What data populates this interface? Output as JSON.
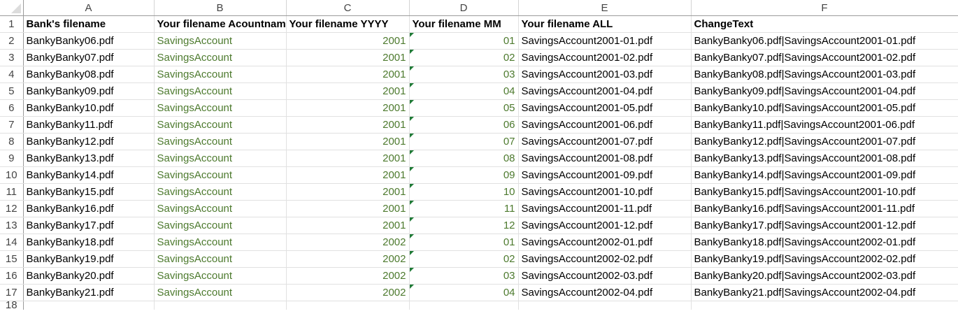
{
  "columns": [
    "A",
    "B",
    "C",
    "D",
    "E",
    "F"
  ],
  "header_row": {
    "num": "1",
    "cells": [
      "Bank's filename",
      "Your filename Acountname",
      "Your filename YYYY",
      "Your filename MM",
      "Your filename ALL",
      "ChangeText"
    ]
  },
  "rows": [
    {
      "num": "2",
      "bank": "BankyBanky06.pdf",
      "acct": "SavingsAccount",
      "yyyy": "2001",
      "mm": "01",
      "all": "SavingsAccount2001-01.pdf",
      "change": "BankyBanky06.pdf|SavingsAccount2001-01.pdf"
    },
    {
      "num": "3",
      "bank": "BankyBanky07.pdf",
      "acct": "SavingsAccount",
      "yyyy": "2001",
      "mm": "02",
      "all": "SavingsAccount2001-02.pdf",
      "change": "BankyBanky07.pdf|SavingsAccount2001-02.pdf"
    },
    {
      "num": "4",
      "bank": "BankyBanky08.pdf",
      "acct": "SavingsAccount",
      "yyyy": "2001",
      "mm": "03",
      "all": "SavingsAccount2001-03.pdf",
      "change": "BankyBanky08.pdf|SavingsAccount2001-03.pdf"
    },
    {
      "num": "5",
      "bank": "BankyBanky09.pdf",
      "acct": "SavingsAccount",
      "yyyy": "2001",
      "mm": "04",
      "all": "SavingsAccount2001-04.pdf",
      "change": "BankyBanky09.pdf|SavingsAccount2001-04.pdf"
    },
    {
      "num": "6",
      "bank": "BankyBanky10.pdf",
      "acct": "SavingsAccount",
      "yyyy": "2001",
      "mm": "05",
      "all": "SavingsAccount2001-05.pdf",
      "change": "BankyBanky10.pdf|SavingsAccount2001-05.pdf"
    },
    {
      "num": "7",
      "bank": "BankyBanky11.pdf",
      "acct": "SavingsAccount",
      "yyyy": "2001",
      "mm": "06",
      "all": "SavingsAccount2001-06.pdf",
      "change": "BankyBanky11.pdf|SavingsAccount2001-06.pdf"
    },
    {
      "num": "8",
      "bank": "BankyBanky12.pdf",
      "acct": "SavingsAccount",
      "yyyy": "2001",
      "mm": "07",
      "all": "SavingsAccount2001-07.pdf",
      "change": "BankyBanky12.pdf|SavingsAccount2001-07.pdf"
    },
    {
      "num": "9",
      "bank": "BankyBanky13.pdf",
      "acct": "SavingsAccount",
      "yyyy": "2001",
      "mm": "08",
      "all": "SavingsAccount2001-08.pdf",
      "change": "BankyBanky13.pdf|SavingsAccount2001-08.pdf"
    },
    {
      "num": "10",
      "bank": "BankyBanky14.pdf",
      "acct": "SavingsAccount",
      "yyyy": "2001",
      "mm": "09",
      "all": "SavingsAccount2001-09.pdf",
      "change": "BankyBanky14.pdf|SavingsAccount2001-09.pdf"
    },
    {
      "num": "11",
      "bank": "BankyBanky15.pdf",
      "acct": "SavingsAccount",
      "yyyy": "2001",
      "mm": "10",
      "all": "SavingsAccount2001-10.pdf",
      "change": "BankyBanky15.pdf|SavingsAccount2001-10.pdf"
    },
    {
      "num": "12",
      "bank": "BankyBanky16.pdf",
      "acct": "SavingsAccount",
      "yyyy": "2001",
      "mm": "11",
      "all": "SavingsAccount2001-11.pdf",
      "change": "BankyBanky16.pdf|SavingsAccount2001-11.pdf"
    },
    {
      "num": "13",
      "bank": "BankyBanky17.pdf",
      "acct": "SavingsAccount",
      "yyyy": "2001",
      "mm": "12",
      "all": "SavingsAccount2001-12.pdf",
      "change": "BankyBanky17.pdf|SavingsAccount2001-12.pdf"
    },
    {
      "num": "14",
      "bank": "BankyBanky18.pdf",
      "acct": "SavingsAccount",
      "yyyy": "2002",
      "mm": "01",
      "all": "SavingsAccount2002-01.pdf",
      "change": "BankyBanky18.pdf|SavingsAccount2002-01.pdf"
    },
    {
      "num": "15",
      "bank": "BankyBanky19.pdf",
      "acct": "SavingsAccount",
      "yyyy": "2002",
      "mm": "02",
      "all": "SavingsAccount2002-02.pdf",
      "change": "BankyBanky19.pdf|SavingsAccount2002-02.pdf"
    },
    {
      "num": "16",
      "bank": "BankyBanky20.pdf",
      "acct": "SavingsAccount",
      "yyyy": "2002",
      "mm": "03",
      "all": "SavingsAccount2002-03.pdf",
      "change": "BankyBanky20.pdf|SavingsAccount2002-03.pdf"
    },
    {
      "num": "17",
      "bank": "BankyBanky21.pdf",
      "acct": "SavingsAccount",
      "yyyy": "2002",
      "mm": "04",
      "all": "SavingsAccount2002-04.pdf",
      "change": "BankyBanky21.pdf|SavingsAccount2002-04.pdf"
    }
  ],
  "partial_row": {
    "num": "18"
  },
  "colors": {
    "formula_text": "#4d7a2e",
    "error_flag": "#1f7a36",
    "gridline": "#e1e1e1"
  }
}
